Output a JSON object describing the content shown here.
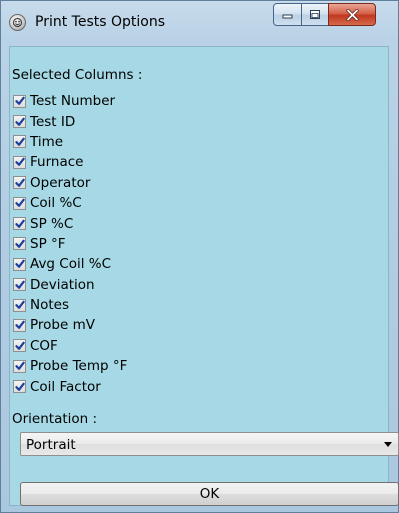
{
  "window": {
    "title": "Print Tests Options",
    "icon": "app-icon"
  },
  "title_buttons": {
    "minimize_icon": "minimize-icon",
    "maximize_icon": "maximize-icon",
    "close_icon": "close-icon"
  },
  "selected_columns": {
    "label": "Selected Columns :",
    "items": [
      {
        "label": "Test Number",
        "checked": true
      },
      {
        "label": "Test ID",
        "checked": true
      },
      {
        "label": "Time",
        "checked": true
      },
      {
        "label": "Furnace",
        "checked": true
      },
      {
        "label": "Operator",
        "checked": true
      },
      {
        "label": "Coil %C",
        "checked": true
      },
      {
        "label": "SP %C",
        "checked": true
      },
      {
        "label": "SP °F",
        "checked": true
      },
      {
        "label": "Avg Coil %C",
        "checked": true
      },
      {
        "label": "Deviation",
        "checked": true
      },
      {
        "label": "Notes",
        "checked": true
      },
      {
        "label": "Probe mV",
        "checked": true
      },
      {
        "label": "COF",
        "checked": true
      },
      {
        "label": "Probe Temp °F",
        "checked": true
      },
      {
        "label": "Coil Factor",
        "checked": true
      }
    ]
  },
  "orientation": {
    "label": "Orientation :",
    "selected": "Portrait"
  },
  "ok_button": {
    "label": "OK"
  },
  "colors": {
    "client_background": "#a6d9e5",
    "close_button": "#c2371f"
  }
}
